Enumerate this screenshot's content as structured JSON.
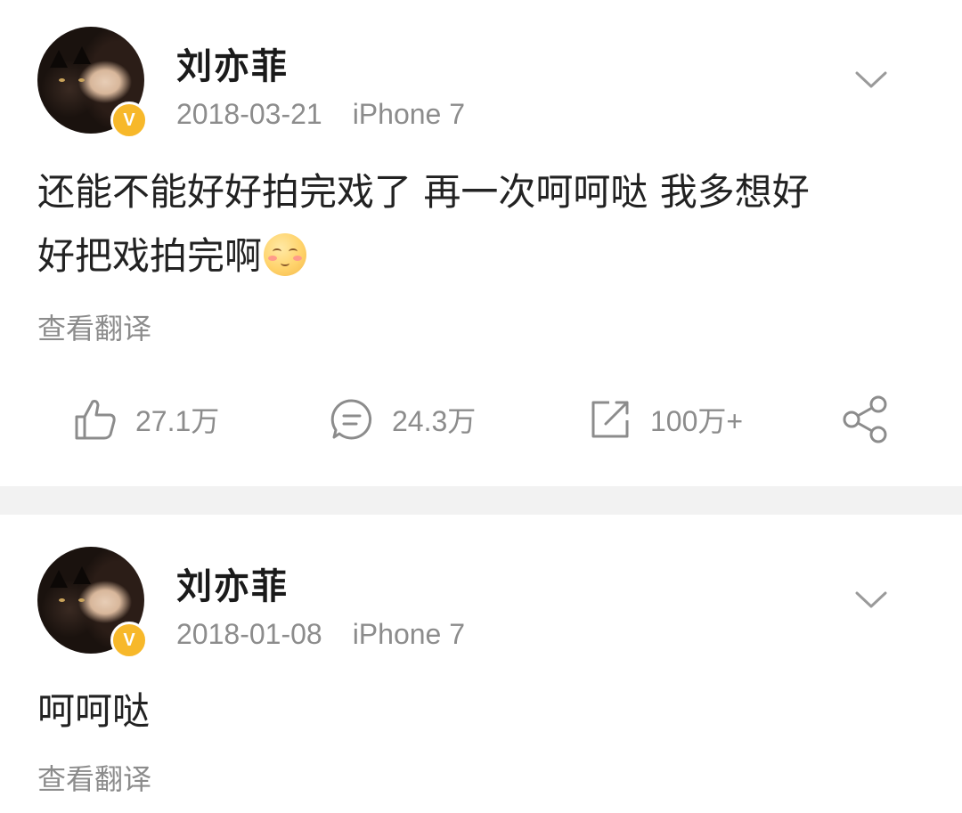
{
  "posts": [
    {
      "author": "刘亦菲",
      "verified_badge": "V",
      "date": "2018-03-21",
      "device": "iPhone 7",
      "content_line1": "还能不能好好拍完戏了 再一次呵呵哒 我多想好",
      "content_line2": "好把戏拍完啊",
      "emoji_icon": "blush-smile-emoji",
      "translate_label": "查看翻译",
      "stats": {
        "likes": "27.1万",
        "comments": "24.3万",
        "reposts": "100万+"
      }
    },
    {
      "author": "刘亦菲",
      "verified_badge": "V",
      "date": "2018-01-08",
      "device": "iPhone 7",
      "content_line1": "呵呵哒",
      "translate_label": "查看翻译"
    }
  ],
  "colors": {
    "badge": "#f7b82a",
    "muted_text": "#8c8c8c",
    "divider": "#f2f2f2"
  },
  "icons": [
    "chevron-down-icon",
    "thumbs-up-icon",
    "comment-icon",
    "repost-icon",
    "share-icon"
  ]
}
